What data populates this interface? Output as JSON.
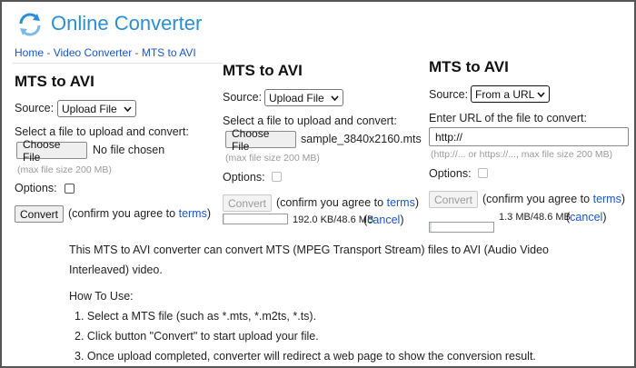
{
  "header": {
    "logo_text": "Online Converter",
    "breadcrumb": [
      "Home",
      "Video Converter",
      "MTS to AVI"
    ],
    "breadcrumb_sep": " - "
  },
  "panel1": {
    "title": "MTS to AVI",
    "source_label": "Source:",
    "source_value": "Upload File",
    "select_prompt": "Select a file to upload and convert:",
    "choose_button": "Choose File",
    "file_name": "No file chosen",
    "max_size": "(max file size 200 MB)",
    "options_label": "Options:",
    "convert_button": "Convert",
    "agree_text": "(confirm you agree to",
    "terms_link": "terms",
    "agree_close": ")"
  },
  "panel2": {
    "title": "MTS to AVI",
    "source_label": "Source:",
    "source_value": "Upload File",
    "select_prompt": "Select a file to upload and convert:",
    "choose_button": "Choose File",
    "file_name": "sample_3840x2160.mts",
    "max_size": "(max file size 200 MB)",
    "options_label": "Options:",
    "convert_button": "Convert",
    "agree_text": "(confirm you agree to",
    "terms_link": "terms",
    "agree_close": ")",
    "progress_text": "192.0 KB/48.6 MB",
    "progress_fraction": 0.004,
    "cancel_open": "(",
    "cancel_link": "cancel",
    "cancel_close": ")"
  },
  "panel3": {
    "title": "MTS to AVI",
    "source_label": "Source:",
    "source_value": "From a URL",
    "url_prompt": "Enter URL of the file to convert:",
    "url_value": "http://",
    "url_hint": "(http://... or https://..., max file size 200 MB)",
    "options_label": "Options:",
    "convert_button": "Convert",
    "agree_text": "(confirm you agree to",
    "terms_link": "terms",
    "agree_close": ")",
    "progress_text": "1.3 MB/48.6 MB",
    "progress_fraction": 0.027,
    "cancel_open": "(",
    "cancel_link": "cancel",
    "cancel_close": ")"
  },
  "description": {
    "intro": "This MTS to AVI converter can convert MTS (MPEG Transport Stream) files to AVI (Audio Video",
    "intro_cont": "Interleaved) video.",
    "how_to": "How To Use:",
    "steps": [
      "1. Select a MTS file (such as *.mts, *.m2ts, *.ts).",
      "2. Click button \"Convert\" to start upload your file.",
      "3. Once upload completed, converter will redirect a web page to show the conversion result."
    ]
  },
  "colors": {
    "link": "#1a56c8",
    "logo": "#2a8ed3",
    "progress_fill": "#cfe3f7"
  }
}
